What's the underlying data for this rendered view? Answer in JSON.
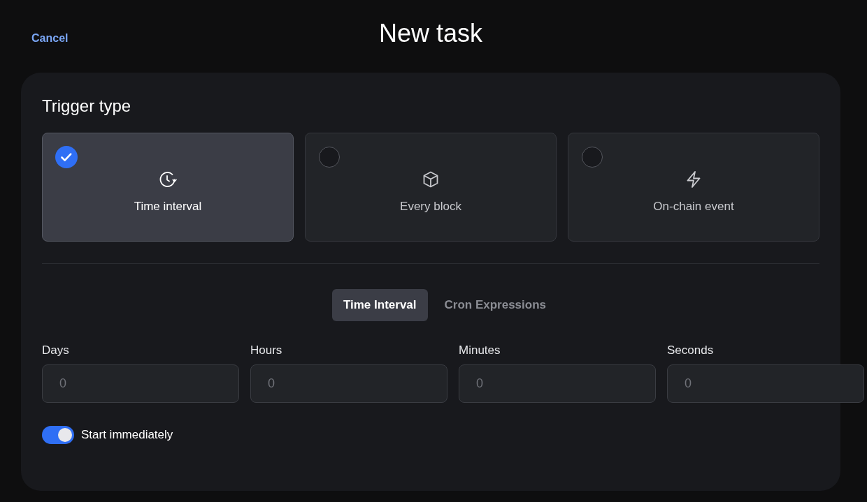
{
  "header": {
    "cancel": "Cancel",
    "title": "New task"
  },
  "trigger": {
    "title": "Trigger type",
    "options": [
      {
        "label": "Time interval",
        "selected": true
      },
      {
        "label": "Every block",
        "selected": false
      },
      {
        "label": "On-chain event",
        "selected": false
      }
    ]
  },
  "tabs": [
    {
      "label": "Time Interval",
      "selected": true
    },
    {
      "label": "Cron Expressions",
      "selected": false
    }
  ],
  "fields": [
    {
      "label": "Days",
      "placeholder": "0"
    },
    {
      "label": "Hours",
      "placeholder": "0"
    },
    {
      "label": "Minutes",
      "placeholder": "0"
    },
    {
      "label": "Seconds",
      "placeholder": "0"
    }
  ],
  "start_immediately": {
    "label": "Start immediately",
    "on": true
  }
}
